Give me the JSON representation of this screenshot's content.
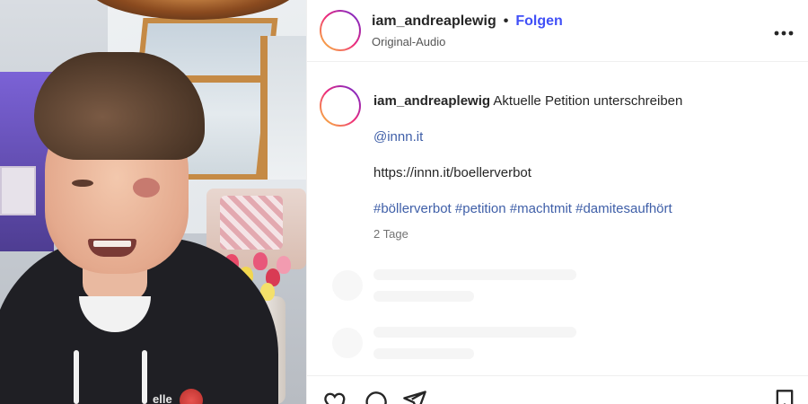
{
  "post": {
    "username": "iam_andreaplewig",
    "separator": "•",
    "follow_label": "Folgen",
    "audio_label": "Original-Audio",
    "more_label": "•••"
  },
  "caption": {
    "username": "iam_andreaplewig",
    "text": "Aktuelle Petition unterschreiben",
    "mention": "@innn.it",
    "url": "https://innn.it/boellerverbot",
    "hashtags": "#böllerverbot #petition #machtmit #damitesaufhört",
    "time": "2 Tage"
  },
  "media": {
    "logo_text": "elle"
  },
  "colors": {
    "accent": "#4150f7",
    "link": "#3f5fa8",
    "ring_start": "#f9ce34",
    "ring_mid": "#ee2a7b",
    "ring_end": "#6228d7"
  },
  "icons": [
    "heart-icon",
    "comment-icon",
    "share-icon",
    "bookmark-icon",
    "more-icon"
  ]
}
